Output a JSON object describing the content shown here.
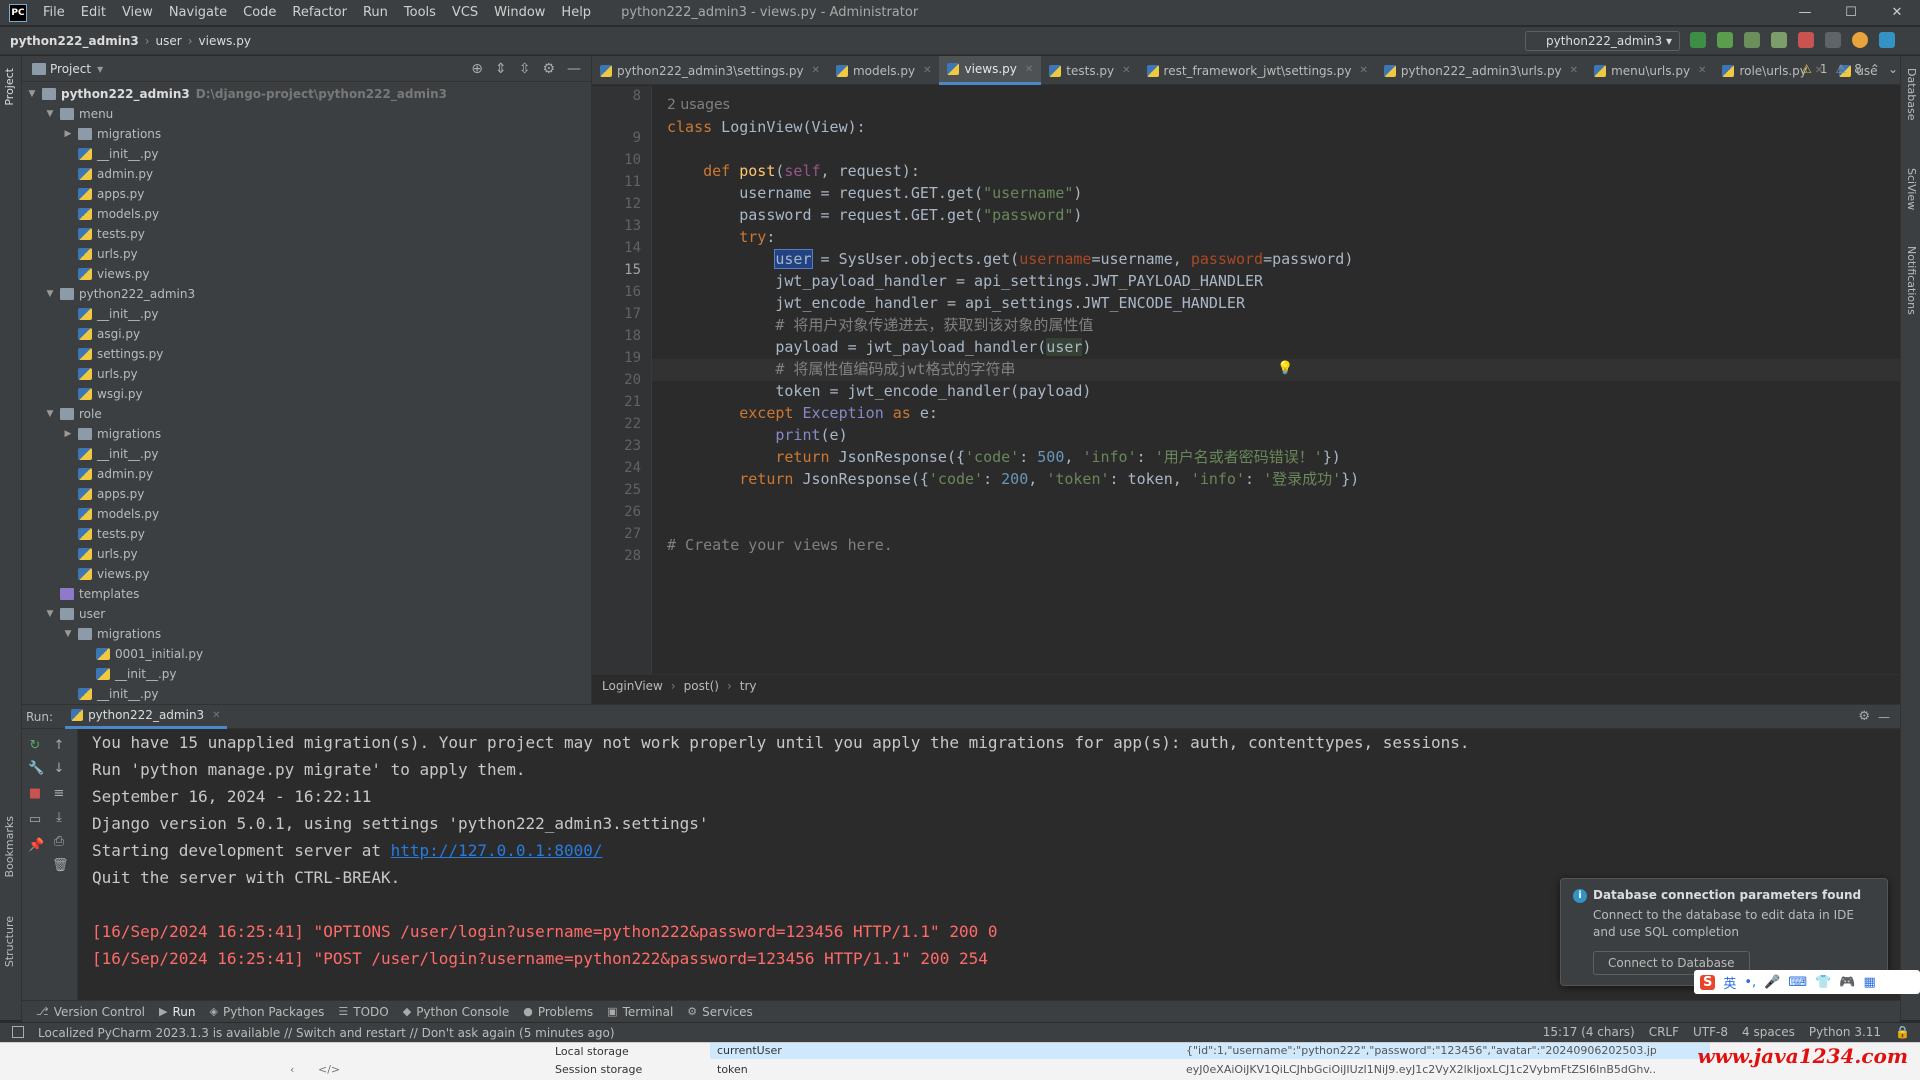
{
  "menubar": {
    "logo": "PC",
    "items": [
      "File",
      "Edit",
      "View",
      "Navigate",
      "Code",
      "Refactor",
      "Run",
      "Tools",
      "VCS",
      "Window",
      "Help"
    ],
    "title": "python222_admin3 - views.py - Administrator"
  },
  "navbar": {
    "project": "python222_admin3",
    "folder": "user",
    "file": "views.py",
    "run_config": "python222_admin3"
  },
  "left_strip": {
    "project": "Project",
    "bookmarks": "Bookmarks",
    "structure": "Structure"
  },
  "project_panel": {
    "title": "Project",
    "root": {
      "name": "python222_admin3",
      "path": "D:\\django-project\\python222_admin3"
    },
    "tree": [
      {
        "label": "menu",
        "type": "folder",
        "depth": 1,
        "open": true
      },
      {
        "label": "migrations",
        "type": "folder",
        "depth": 2,
        "open": false
      },
      {
        "label": "__init__.py",
        "type": "py",
        "depth": 2
      },
      {
        "label": "admin.py",
        "type": "py",
        "depth": 2
      },
      {
        "label": "apps.py",
        "type": "py",
        "depth": 2
      },
      {
        "label": "models.py",
        "type": "py",
        "depth": 2
      },
      {
        "label": "tests.py",
        "type": "py",
        "depth": 2
      },
      {
        "label": "urls.py",
        "type": "py",
        "depth": 2
      },
      {
        "label": "views.py",
        "type": "py",
        "depth": 2
      },
      {
        "label": "python222_admin3",
        "type": "folder",
        "depth": 1,
        "open": true
      },
      {
        "label": "__init__.py",
        "type": "py",
        "depth": 2
      },
      {
        "label": "asgi.py",
        "type": "py",
        "depth": 2
      },
      {
        "label": "settings.py",
        "type": "py",
        "depth": 2
      },
      {
        "label": "urls.py",
        "type": "py",
        "depth": 2
      },
      {
        "label": "wsgi.py",
        "type": "py",
        "depth": 2
      },
      {
        "label": "role",
        "type": "folder",
        "depth": 1,
        "open": true
      },
      {
        "label": "migrations",
        "type": "folder",
        "depth": 2,
        "open": false
      },
      {
        "label": "__init__.py",
        "type": "py",
        "depth": 2
      },
      {
        "label": "admin.py",
        "type": "py",
        "depth": 2
      },
      {
        "label": "apps.py",
        "type": "py",
        "depth": 2
      },
      {
        "label": "models.py",
        "type": "py",
        "depth": 2
      },
      {
        "label": "tests.py",
        "type": "py",
        "depth": 2
      },
      {
        "label": "urls.py",
        "type": "py",
        "depth": 2
      },
      {
        "label": "views.py",
        "type": "py",
        "depth": 2
      },
      {
        "label": "templates",
        "type": "tpl",
        "depth": 1
      },
      {
        "label": "user",
        "type": "folder",
        "depth": 1,
        "open": true
      },
      {
        "label": "migrations",
        "type": "folder",
        "depth": 2,
        "open": true
      },
      {
        "label": "0001_initial.py",
        "type": "py",
        "depth": 3
      },
      {
        "label": "__init__.py",
        "type": "py",
        "depth": 3
      },
      {
        "label": "__init__.py",
        "type": "py",
        "depth": 2
      }
    ]
  },
  "editor": {
    "tabs": [
      {
        "label": "python222_admin3\\settings.py",
        "active": false
      },
      {
        "label": "models.py",
        "active": false
      },
      {
        "label": "views.py",
        "active": true
      },
      {
        "label": "tests.py",
        "active": false
      },
      {
        "label": "rest_framework_jwt\\settings.py",
        "active": false
      },
      {
        "label": "python222_admin3\\urls.py",
        "active": false
      },
      {
        "label": "menu\\urls.py",
        "active": false
      },
      {
        "label": "role\\urls.py",
        "active": false
      },
      {
        "label": "use",
        "active": false
      }
    ],
    "inspection": {
      "warnings": "1",
      "weak": "8"
    },
    "usages": "2 usages",
    "line_numbers": [
      "8",
      "9",
      "10",
      "11",
      "12",
      "13",
      "14",
      "15",
      "16",
      "17",
      "18",
      "19",
      "20",
      "21",
      "22",
      "23",
      "24",
      "25",
      "26",
      "27",
      "28"
    ],
    "breadcrumb": [
      "LoginView",
      "post()",
      "try"
    ]
  },
  "run": {
    "label": "Run:",
    "tab": "python222_admin3",
    "lines": [
      "You have 15 unapplied migration(s). Your project may not work properly until you apply the migrations for app(s): auth, contenttypes, sessions.",
      "Run 'python manage.py migrate' to apply them.",
      "September 16, 2024 - 16:22:11",
      "Django version 5.0.1, using settings 'python222_admin3.settings'",
      "Starting development server at ",
      "Quit the server with CTRL-BREAK."
    ],
    "server_url": "http://127.0.0.1:8000/",
    "log_lines": [
      "[16/Sep/2024 16:25:41] \"OPTIONS /user/login?username=python222&password=123456 HTTP/1.1\" 200 0",
      "[16/Sep/2024 16:25:41] \"POST /user/login?username=python222&password=123456 HTTP/1.1\" 200 254"
    ]
  },
  "notification": {
    "title": "Database connection parameters found",
    "body": "Connect to the database to edit data in IDE and use SQL completion",
    "button": "Connect to Database"
  },
  "toolwindows": [
    "Version Control",
    "Run",
    "Python Packages",
    "TODO",
    "Python Console",
    "Problems",
    "Terminal",
    "Services"
  ],
  "statusbar": {
    "message": "Localized PyCharm 2023.1.3 is available // Switch and restart // Don't ask again (5 minutes ago)",
    "position": "15:17 (4 chars)",
    "line_sep": "CRLF",
    "encoding": "UTF-8",
    "indent": "4 spaces",
    "interpreter": "Python 3.11"
  },
  "right_strip": {
    "database": "Database",
    "sciview": "SciView",
    "notifications": "Notifications"
  },
  "devtools": {
    "local_storage": "Local storage",
    "session_storage": "Session storage",
    "key1": "currentUser",
    "key2": "token",
    "val1": "{\"id\":1,\"username\":\"python222\",\"password\":\"123456\",\"avatar\":\"20240906202503.jpg\",...",
    "val2": "eyJ0eXAiOiJKV1QiLCJhbGciOiJIUzI1NiJ9.eyJ1c2VyX2lkIjoxLCJ1c2VybmFtZSI6InB5dGhv..."
  },
  "watermark": "www.java1234.com"
}
